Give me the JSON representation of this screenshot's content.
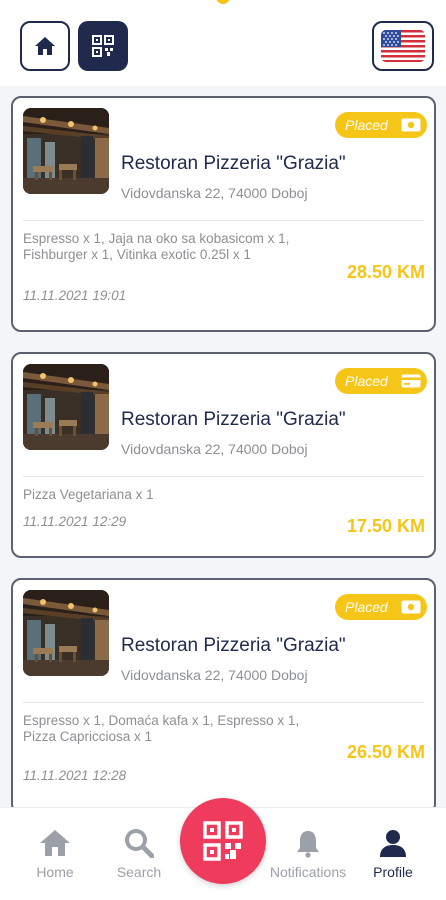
{
  "header": {
    "home_icon": "home-icon",
    "qr_icon": "qr-code-icon",
    "language_flag": "us-flag-icon"
  },
  "orders": [
    {
      "restaurant": "Restoran Pizzeria \"Grazia\"",
      "address": "Vidovdanska 22, 74000 Doboj",
      "status": "Placed",
      "payment_icon": "cash-icon",
      "items": "Espresso x 1, Jaja na oko sa kobasicom x 1, Fishburger x 1, Vitinka exotic 0.25l x 1",
      "datetime": "11.11.2021 19:01",
      "total": "28.50 KM"
    },
    {
      "restaurant": "Restoran Pizzeria \"Grazia\"",
      "address": "Vidovdanska 22, 74000 Doboj",
      "status": "Placed",
      "payment_icon": "card-icon",
      "items": "Pizza Vegetariana x 1",
      "datetime": "11.11.2021 12:29",
      "total": "17.50 KM"
    },
    {
      "restaurant": "Restoran Pizzeria \"Grazia\"",
      "address": "Vidovdanska 22, 74000 Doboj",
      "status": "Placed",
      "payment_icon": "cash-icon",
      "items": "Espresso x 1, Domaća kafa x 1, Espresso x 1, Pizza Capricciosa x 1",
      "datetime": "11.11.2021 12:28",
      "total": "26.50 KM"
    }
  ],
  "nav": {
    "home": "Home",
    "search": "Search",
    "notifications": "Notifications",
    "profile": "Profile",
    "active": "Profile"
  },
  "colors": {
    "navy": "#1f2a4d",
    "accent_yellow": "#f5c518",
    "fab_pink": "#ef3b5c",
    "muted_text": "#8d8f96"
  }
}
